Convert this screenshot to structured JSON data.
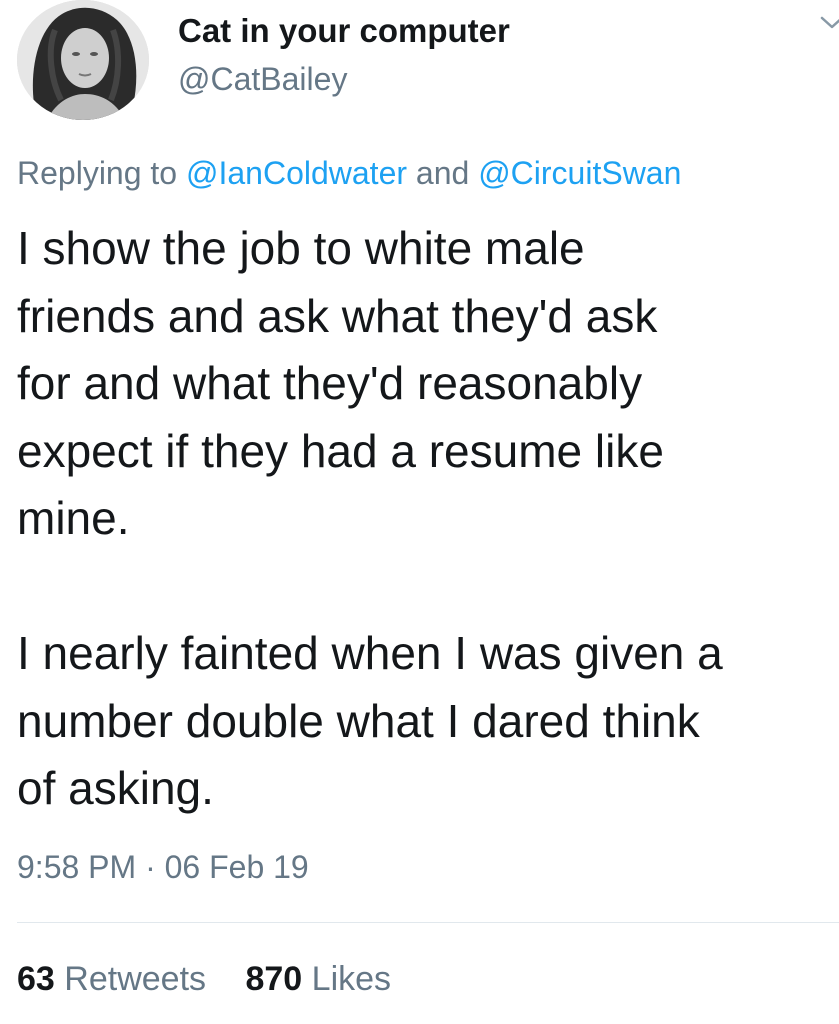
{
  "author": {
    "display_name": "Cat in your computer",
    "handle": "@CatBailey",
    "avatar": "profile-photo"
  },
  "menu_icon": "chevron-down-icon",
  "reply": {
    "prefix": "Replying to",
    "mention_1": "@IanColdwater",
    "joiner": "and",
    "mention_2": "@CircuitSwan"
  },
  "body": {
    "paragraph_1": [
      "I show the job to white male",
      "friends and ask what they'd ask",
      "for and what they'd reasonably",
      "expect if they had a resume like",
      "mine."
    ],
    "paragraph_2": [
      "I nearly fainted when I was given a",
      "number double what I dared think",
      "of asking."
    ]
  },
  "timestamp": {
    "time": "9:58 PM",
    "separator": "·",
    "date": "06 Feb 19"
  },
  "stats": {
    "retweets_count": "63",
    "retweets_label": "Retweets",
    "likes_count": "870",
    "likes_label": "Likes"
  },
  "colors": {
    "text": "#14171a",
    "secondary": "#657786",
    "link": "#1da1f2",
    "divider": "#e1e8ed"
  }
}
